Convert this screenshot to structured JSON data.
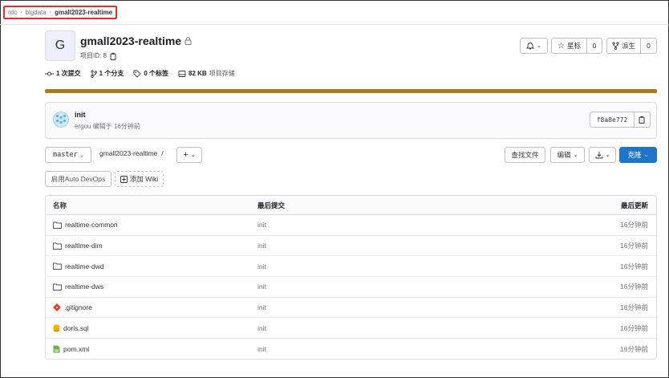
{
  "breadcrumb": {
    "items": [
      "rdc",
      "bigdata"
    ],
    "current": "gmall2023-realtime"
  },
  "project": {
    "avatar_letter": "G",
    "name": "gmall2023-realtime",
    "id_text": "项目ID: 8"
  },
  "actions": {
    "star_label": "星标",
    "star_count": "0",
    "fork_label": "派生",
    "fork_count": "0"
  },
  "stats": {
    "commits": "1 次提交",
    "branches": "1 个分支",
    "tags": "0 个标签",
    "storage_size": "82 KB",
    "storage_label": "项目存储"
  },
  "language_bar_color": "#a87b1d",
  "last_commit": {
    "message": "init",
    "meta": "ergou 编辑于 16分钟前",
    "sha": "f8a8e772"
  },
  "toolbar": {
    "branch": "master",
    "path": "gmall2023-realtime",
    "path_sep": "/",
    "add_label": "+",
    "find_file": "查找文件",
    "edit": "编辑",
    "clone": "克隆"
  },
  "quick_actions": {
    "auto_devops": "启用Auto DevOps",
    "add_wiki": "添加 Wiki"
  },
  "table": {
    "headers": {
      "name": "名称",
      "last_commit": "最后提交",
      "last_update": "最后更新"
    },
    "rows": [
      {
        "name": "realtime-common",
        "icon": "folder-icon",
        "commit": "init",
        "updated": "16分钟前"
      },
      {
        "name": "realtime-dim",
        "icon": "folder-icon",
        "commit": "init",
        "updated": "16分钟前"
      },
      {
        "name": "realtime-dwd",
        "icon": "folder-icon",
        "commit": "init",
        "updated": "16分钟前"
      },
      {
        "name": "realtime-dws",
        "icon": "folder-icon",
        "commit": "init",
        "updated": "16分钟前"
      },
      {
        "name": ".gitignore",
        "icon": "git-file-icon",
        "commit": "init",
        "updated": "16分钟前"
      },
      {
        "name": "doris.sql",
        "icon": "database-file-icon",
        "commit": "init",
        "updated": "16分钟前"
      },
      {
        "name": "pom.xml",
        "icon": "xml-file-icon",
        "commit": "init",
        "updated": "16分钟前"
      }
    ]
  }
}
